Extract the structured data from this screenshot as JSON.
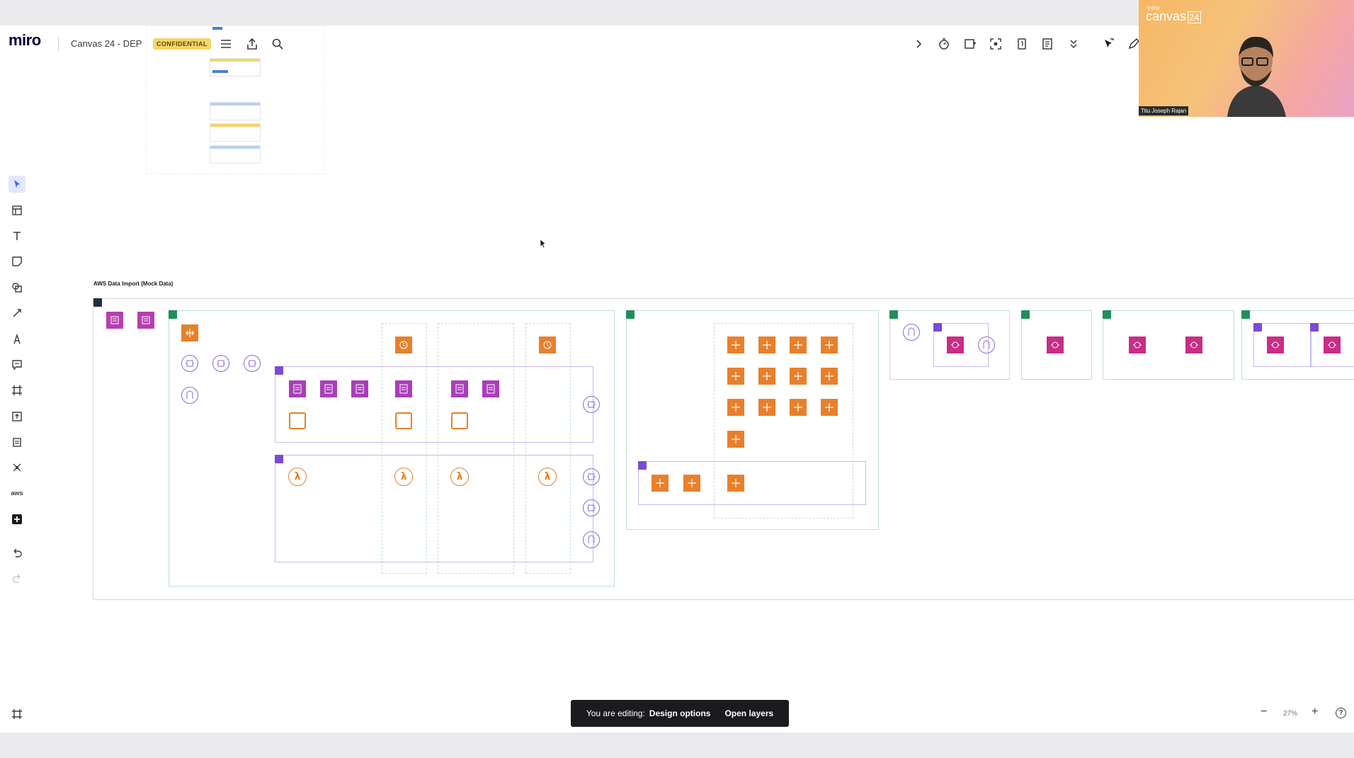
{
  "header": {
    "logo": "miro",
    "board_title": "Canvas 24 - DEP",
    "badge": "CONFIDENTIAL",
    "menu_icon": "hamburger-icon",
    "share_icon": "upload-icon",
    "search_icon": "search-icon"
  },
  "right_toolbar": {
    "icons": [
      "chevron-right-icon",
      "timer-icon",
      "voting-icon",
      "focus-icon",
      "counter-icon",
      "notes-icon",
      "more-chevron-icon",
      "pointer-icon",
      "pen-icon"
    ]
  },
  "left_toolbar": {
    "tools": [
      "select",
      "templates",
      "text",
      "sticky-note",
      "shapes",
      "pen",
      "draw",
      "comment",
      "frame",
      "upload",
      "stack",
      "mind-map",
      "aws",
      "add"
    ],
    "aws_label": "aws"
  },
  "diagram": {
    "title": "AWS Data Import (Mock Data)"
  },
  "status": {
    "editing_prefix": "You are editing:",
    "editing_target": "Design options",
    "open_layers": "Open layers"
  },
  "zoom": {
    "level": "27%",
    "minus": "−",
    "plus": "+",
    "help": "?"
  },
  "video": {
    "brand": "miro",
    "event": "canvas",
    "event_num": "24",
    "participant": "Titu Joseph Rajan"
  },
  "colors": {
    "orange": "#e8802b",
    "pink": "#c92d87",
    "green": "#1f8f5a",
    "purple": "#7b4ad8",
    "badge": "#f6d56b"
  }
}
